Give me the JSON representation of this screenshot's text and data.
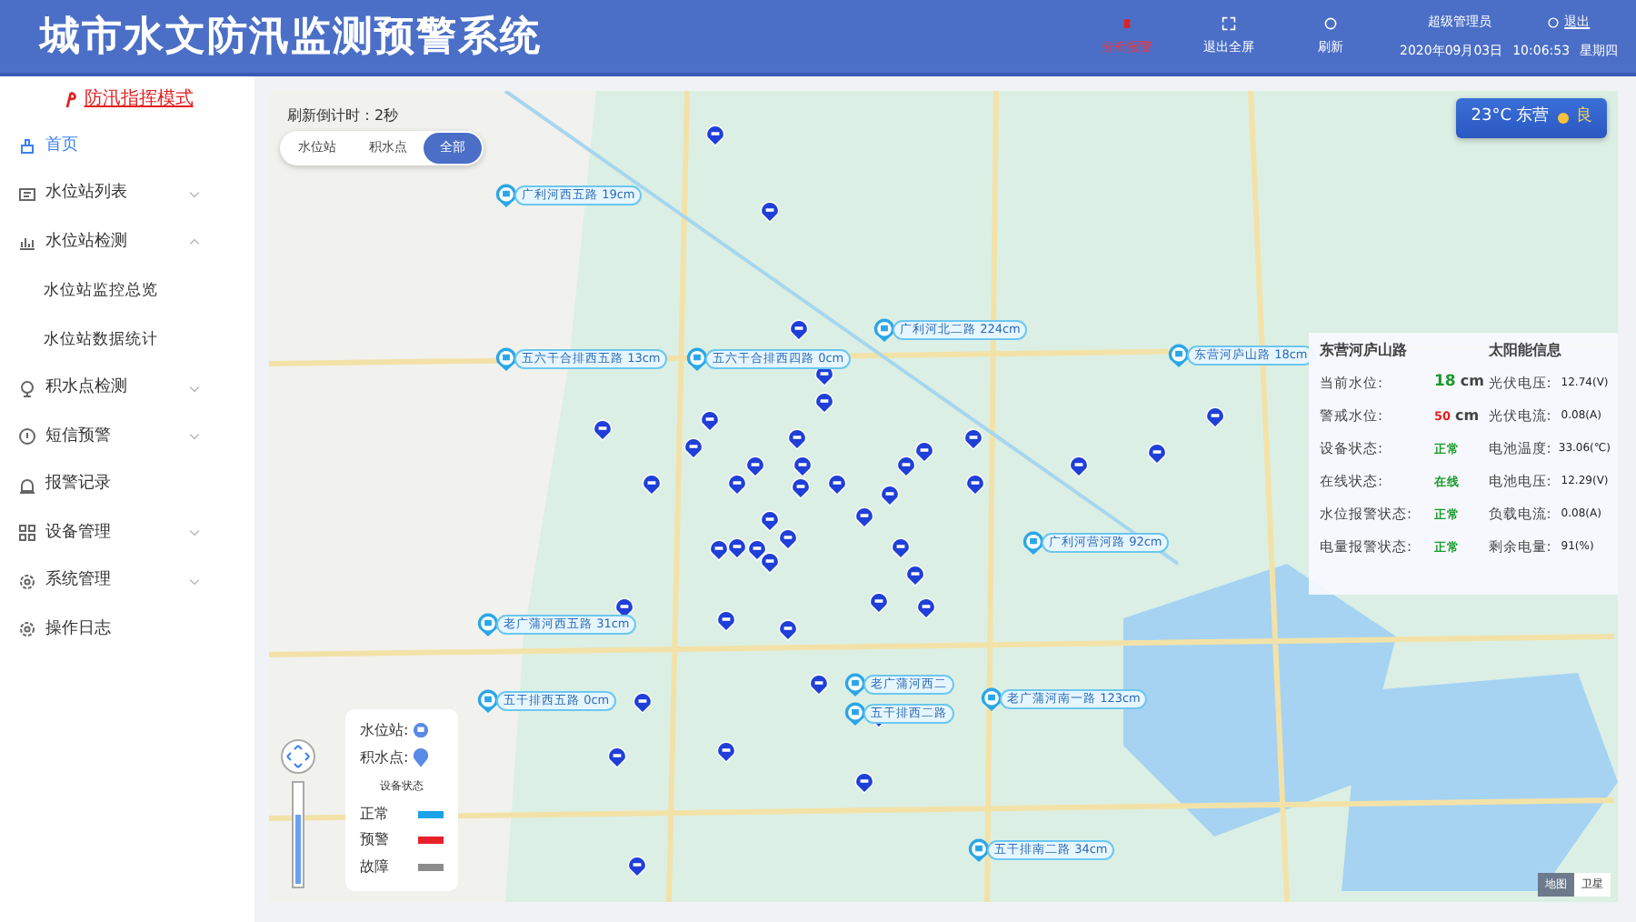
{
  "header": {
    "title": "城市水文防汛监测预警系统",
    "actions": [
      {
        "label": "分析报警",
        "kind": "alarm"
      },
      {
        "label": "退出全屏",
        "kind": "fullscreen"
      },
      {
        "label": "刷新",
        "kind": "refresh"
      }
    ],
    "user": "超级管理员",
    "logout": "退出",
    "date": "2020年09月03日",
    "time": "10:06:53",
    "weekday": "星期四"
  },
  "sidebar": {
    "mode_link": "防汛指挥模式",
    "items": [
      {
        "label": "首页",
        "kind": "home",
        "selected": true
      },
      {
        "label": "水位站列表",
        "kind": "list",
        "selected": false,
        "expanded": false
      },
      {
        "label": "水位站检测",
        "kind": "chart",
        "selected": false,
        "expanded": true,
        "children": [
          {
            "label": "水位站监控总览",
            "selected": false
          },
          {
            "label": "水位站数据统计",
            "selected": false
          }
        ]
      },
      {
        "label": "积水点检测",
        "kind": "camera",
        "selected": false,
        "expanded": false
      },
      {
        "label": "短信预警",
        "kind": "message",
        "selected": false,
        "expanded": false
      },
      {
        "label": "报警记录",
        "kind": "siren",
        "selected": false
      },
      {
        "label": "设备管理",
        "kind": "grid",
        "selected": false,
        "expanded": false
      },
      {
        "label": "系统管理",
        "kind": "gear",
        "selected": false,
        "expanded": false
      },
      {
        "label": "操作日志",
        "kind": "gear",
        "selected": false
      }
    ]
  },
  "map": {
    "countdown": "刷新倒计时：2秒",
    "filters": [
      {
        "label": "水位站",
        "selected": false
      },
      {
        "label": "积水点",
        "selected": false
      },
      {
        "label": "全部",
        "selected": true
      }
    ],
    "weather": {
      "temp": "23°C",
      "city": "东营",
      "quality": "良"
    },
    "stations": [
      {
        "label": "广利河西五路 19cm"
      },
      {
        "label": "五六干合排西五路 13cm"
      },
      {
        "label": "五六干合排西四路 0cm"
      },
      {
        "label": "广利河北二路 224cm"
      },
      {
        "label": "东营河庐山路 18cm"
      },
      {
        "label": "广利河营河路 92cm"
      },
      {
        "label": "老广蒲河西五路 31cm"
      },
      {
        "label": "五干排西五路 0cm"
      },
      {
        "label": "老广蒲河西二"
      },
      {
        "label": "五干排西二路"
      },
      {
        "label": "老广蒲河南一路 123cm"
      },
      {
        "label": "五干排南二路 34cm"
      }
    ],
    "info": {
      "title": "东营河庐山路",
      "solar_title": "太阳能信息",
      "readings": [
        {
          "label": "当前水位:",
          "value": "18",
          "unit": "cm",
          "kind": "level"
        },
        {
          "label": "警戒水位:",
          "value": "50",
          "unit": "cm",
          "kind": "alert"
        },
        {
          "label": "设备状态:",
          "value": "正常",
          "kind": "status"
        },
        {
          "label": "在线状态:",
          "value": "在线",
          "kind": "status"
        },
        {
          "label": "水位报警状态:",
          "value": "正常",
          "kind": "status"
        },
        {
          "label": "电量报警状态:",
          "value": "正常",
          "kind": "status"
        }
      ],
      "solar": [
        {
          "label": "光伏电压:",
          "value": "12.74(V)"
        },
        {
          "label": "光伏电流:",
          "value": "0.08(A)"
        },
        {
          "label": "电池温度:",
          "value": "33.06(℃)"
        },
        {
          "label": "电池电压:",
          "value": "12.29(V)"
        },
        {
          "label": "负载电流:",
          "value": "0.08(A)"
        },
        {
          "label": "剩余电量:",
          "value": "91(%)"
        }
      ]
    },
    "legend": {
      "station": "水位站:",
      "point": "积水点:",
      "status_title": "设备状态",
      "statuses": [
        {
          "label": "正常",
          "color": "#1aa3e8"
        },
        {
          "label": "预警",
          "color": "#e8202a"
        },
        {
          "label": "故障",
          "color": "#8c8c8c"
        }
      ]
    },
    "map_types": [
      {
        "label": "地图",
        "selected": true
      },
      {
        "label": "卫星",
        "selected": false
      }
    ]
  }
}
